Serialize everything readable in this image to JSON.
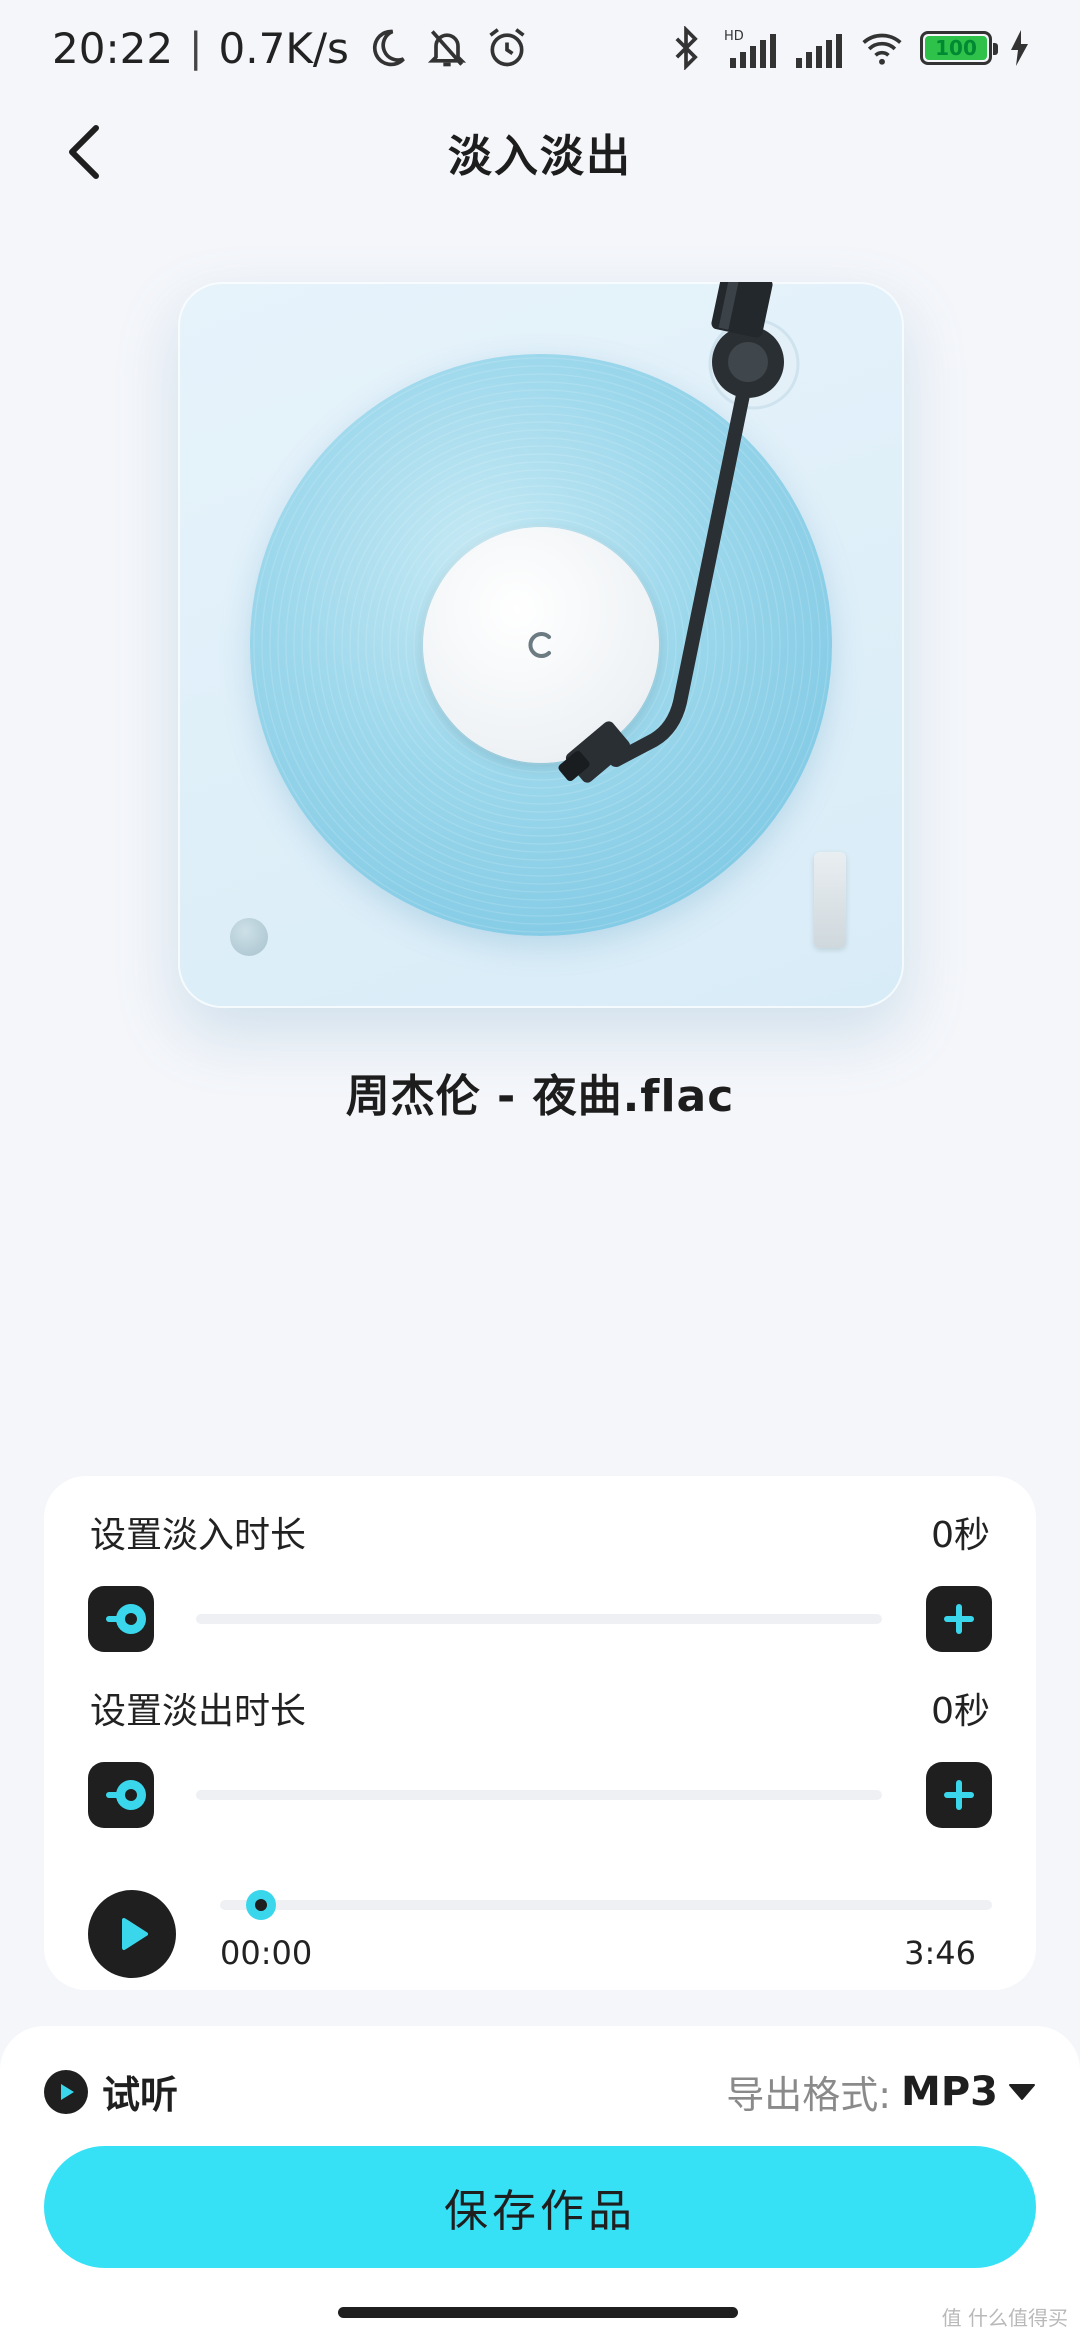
{
  "status_bar": {
    "time": "20:22",
    "separator": "|",
    "net_speed": "0.7K/s",
    "hd_label": "HD",
    "battery_level": "100"
  },
  "header": {
    "title": "淡入淡出"
  },
  "track": {
    "name": "周杰伦 - 夜曲.flac"
  },
  "fade_in": {
    "label": "设置淡入时长",
    "value": "0秒",
    "slider_fraction": 0
  },
  "fade_out": {
    "label": "设置淡出时长",
    "value": "0秒",
    "slider_fraction": 0
  },
  "playback": {
    "current_time": "00:00",
    "total_time": "3:46",
    "progress_fraction": 0
  },
  "bottom": {
    "preview_label": "试听",
    "format_label": "导出格式:",
    "format_value": "MP3",
    "save_label": "保存作品"
  },
  "watermark": "值 什么值得买",
  "colors": {
    "accent": "#36e1f6",
    "dark": "#1f1f1f",
    "record_blue": "#74c3e1",
    "background": "#f4f6fa"
  }
}
